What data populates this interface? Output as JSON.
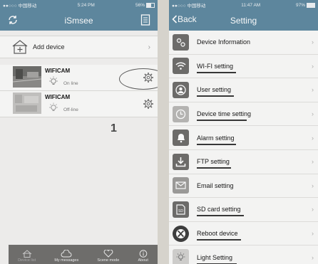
{
  "left": {
    "status": {
      "carrier": "●●○○○ 中国移动",
      "time": "5:24 PM",
      "battery": "56%"
    },
    "title": "iSmsee",
    "add_device": "Add device",
    "devices": [
      {
        "name": "WIFICAM",
        "status": "On line"
      },
      {
        "name": "WIFICAM",
        "status": "Off-line"
      }
    ],
    "annotation_number": "1",
    "tabs": [
      "Device list",
      "My messages",
      "Scene mode",
      "About"
    ]
  },
  "right": {
    "status": {
      "carrier": "●●○○○ 中国移动",
      "time": "11:47 AM",
      "battery": "97%"
    },
    "back": "Back",
    "title": "Setting",
    "items": [
      {
        "label": "Device Information",
        "icon": "info-icon"
      },
      {
        "label": "WI-FI setting",
        "icon": "wifi-icon"
      },
      {
        "label": "User setting",
        "icon": "user-icon"
      },
      {
        "label": "Device time setting",
        "icon": "clock-icon"
      },
      {
        "label": "Alarm setting",
        "icon": "bell-icon"
      },
      {
        "label": "FTP setting",
        "icon": "download-icon"
      },
      {
        "label": "Email setting",
        "icon": "mail-icon"
      },
      {
        "label": "SD card setting",
        "icon": "sd-card-icon"
      },
      {
        "label": "Reboot device",
        "icon": "xbox-icon"
      },
      {
        "label": "Light Setting",
        "icon": "light-icon"
      }
    ]
  },
  "colors": {
    "accent": "#2f8fc6",
    "tabbar": "#6e6c68"
  }
}
